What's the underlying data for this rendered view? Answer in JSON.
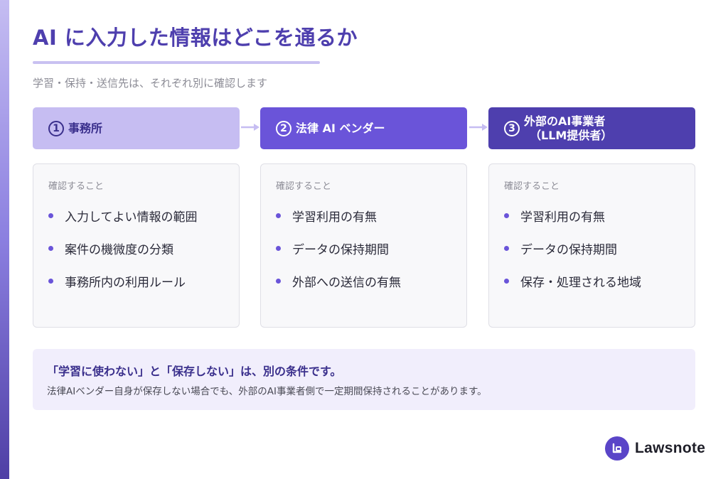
{
  "title": "AI に入力した情報はどこを通るか",
  "subtitle": "学習・保持・送信先は、それぞれ別に確認します",
  "steps": [
    {
      "number": "1",
      "label": "事務所",
      "label_sub": "",
      "caption": "確認すること",
      "items": [
        "入力してよい情報の範囲",
        "案件の機微度の分類",
        "事務所内の利用ルール"
      ]
    },
    {
      "number": "2",
      "label": "法律 AI ベンダー",
      "label_sub": "",
      "caption": "確認すること",
      "items": [
        "学習利用の有無",
        "データの保持期間",
        "外部への送信の有無"
      ]
    },
    {
      "number": "3",
      "label": "外部のAI事業者",
      "label_sub": "（LLM提供者）",
      "caption": "確認すること",
      "items": [
        "学習利用の有無",
        "データの保持期間",
        "保存・処理される地域"
      ]
    }
  ],
  "note": {
    "title": "「学習に使わない」と「保存しない」は、別の条件です。",
    "body": "法律AIベンダー自身が保存しない場合でも、外部のAI事業者側で一定期間保持されることがあります。"
  },
  "brand": {
    "name": "Lawsnote",
    "logo_icon": "lawsnote-logo-icon"
  },
  "colors": {
    "accent": "#4e3fae",
    "step1": "#c6bdf2",
    "step2": "#6a54d9",
    "step3": "#4e3fae",
    "note_bg": "#f1eefc"
  }
}
